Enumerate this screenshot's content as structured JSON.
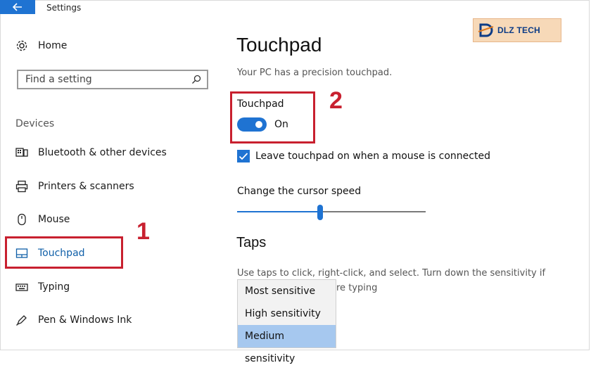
{
  "window": {
    "title": "Settings"
  },
  "sidebar": {
    "home_label": "Home",
    "search_placeholder": "Find a setting",
    "section_label": "Devices",
    "items": [
      {
        "label": "Bluetooth & other devices",
        "icon": "bluetooth-devices-icon"
      },
      {
        "label": "Printers & scanners",
        "icon": "printer-icon"
      },
      {
        "label": "Mouse",
        "icon": "mouse-icon"
      },
      {
        "label": "Touchpad",
        "icon": "touchpad-icon",
        "active": true
      },
      {
        "label": "Typing",
        "icon": "keyboard-icon"
      },
      {
        "label": "Pen & Windows Ink",
        "icon": "pen-icon"
      }
    ]
  },
  "main": {
    "title": "Touchpad",
    "subtitle": "Your PC has a precision touchpad.",
    "touchpad_label": "Touchpad",
    "toggle_state": "On",
    "checkbox_label": "Leave touchpad on when a mouse is connected",
    "cursor_speed_label": "Change the cursor speed",
    "cursor_speed_fraction": 0.44,
    "taps_heading": "Taps",
    "taps_desc_1": "Use taps to click, right-click, and select. Turn down the sensitivity if",
    "taps_desc_2": "re typing",
    "sensitivity_options": [
      "Most sensitive",
      "High sensitivity",
      "Medium sensitivity"
    ],
    "selected_sensitivity": "Medium sensitivity"
  },
  "annotations": {
    "marker_1": "1",
    "marker_2": "2",
    "color": "#c8202f"
  },
  "logo": {
    "text": "DLZ TECH"
  },
  "colors": {
    "accent": "#1f73d2",
    "selected_row": "#a6c8ef"
  }
}
